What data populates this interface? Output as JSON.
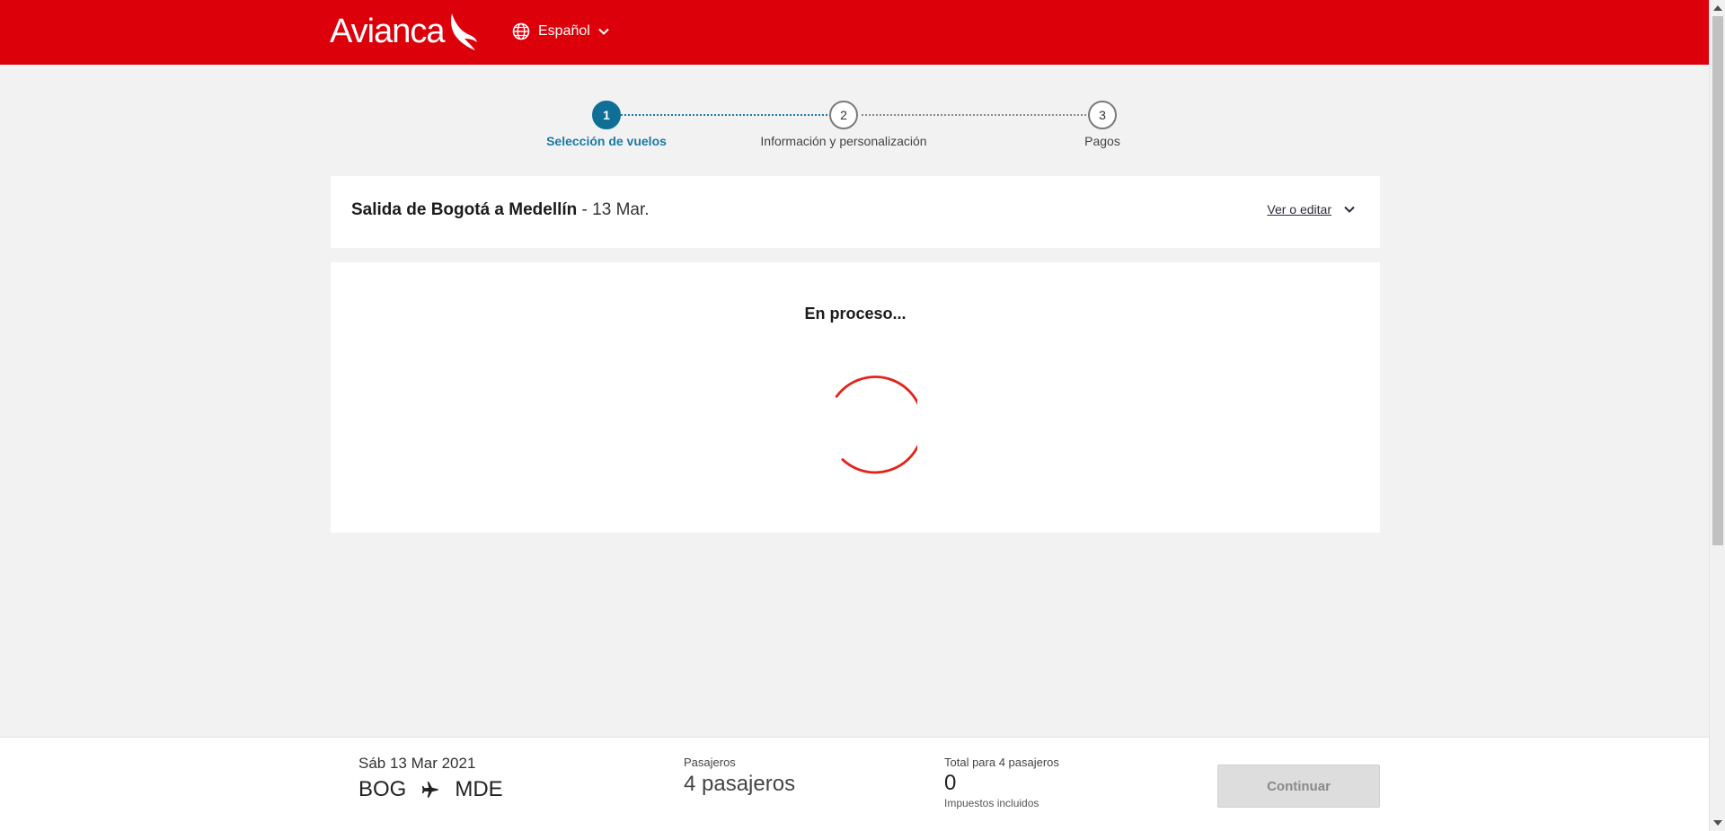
{
  "header": {
    "brand": "Avianca",
    "language": "Español",
    "brand_color": "#dc000b"
  },
  "stepper": {
    "steps": [
      {
        "number": "1",
        "label": "Selección de vuelos",
        "active": true
      },
      {
        "number": "2",
        "label": "Información y personalización",
        "active": false
      },
      {
        "number": "3",
        "label": "Pagos",
        "active": false
      }
    ]
  },
  "flight": {
    "route": "Salida de Bogotá a Medellín",
    "date": " - 13 Mar.",
    "edit_label": "Ver o editar"
  },
  "loading": {
    "text": "En proceso...",
    "spinner_color": "#e2231a"
  },
  "footer": {
    "date": "Sáb 13 Mar 2021",
    "origin": "BOG",
    "destination": "MDE",
    "passengers_label": "Pasajeros",
    "passengers_value": "4 pasajeros",
    "total_label": "Total para 4 pasajeros",
    "total_value": "0",
    "taxes_note": "Impuestos incluidos",
    "continue_label": "Continuar"
  },
  "icons": {
    "globe": "globe-icon",
    "chevron": "chevron-down-icon",
    "plane": "plane-icon"
  }
}
